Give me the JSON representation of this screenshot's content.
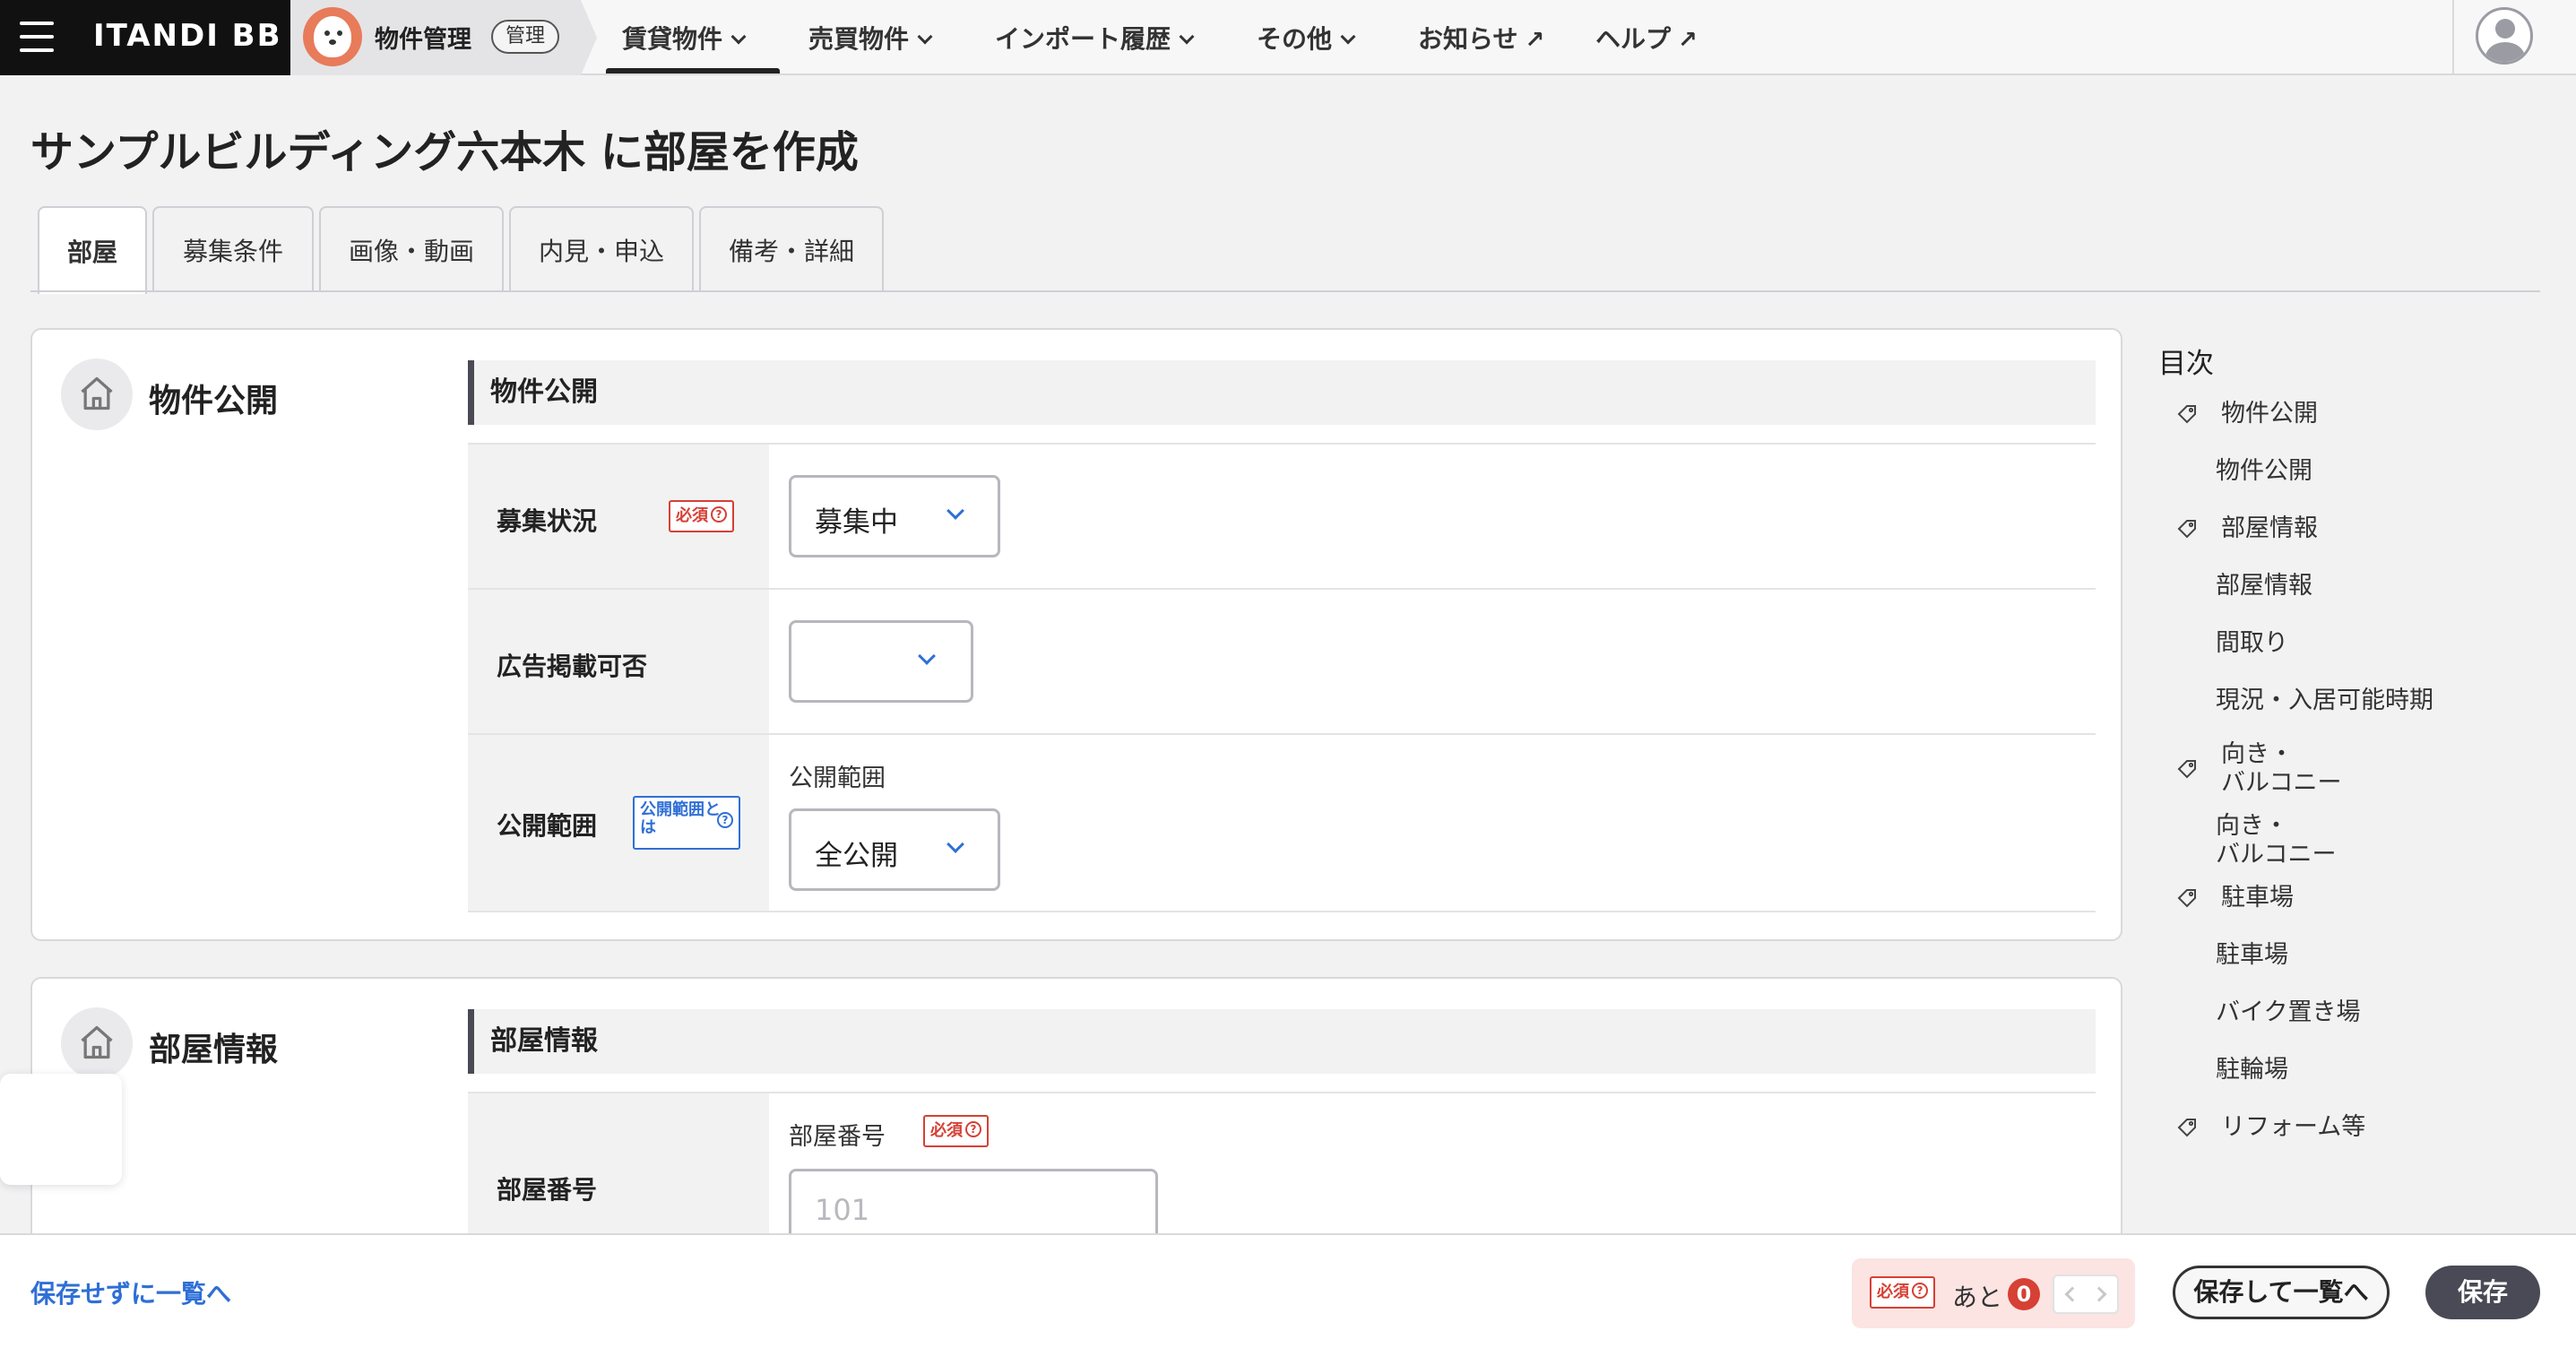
{
  "header": {
    "brand": "ITANDI BB",
    "product": "物件管理",
    "role_badge": "管理",
    "nav": [
      {
        "label": "賃貸物件",
        "icon": "chevron-down-icon"
      },
      {
        "label": "売買物件",
        "icon": "chevron-down-icon"
      },
      {
        "label": "インポート履歴",
        "icon": "chevron-down-icon"
      },
      {
        "label": "その他",
        "icon": "chevron-down-icon"
      },
      {
        "label": "お知らせ",
        "icon": "external-link-icon"
      },
      {
        "label": "ヘルプ",
        "icon": "external-link-icon"
      }
    ]
  },
  "page": {
    "title": "サンプルビルディング六本木 に部屋を作成",
    "tabs": [
      "部屋",
      "募集条件",
      "画像・動画",
      "内見・申込",
      "備考・詳細"
    ],
    "active_tab": "部屋"
  },
  "sections": {
    "publish": {
      "title": "物件公開",
      "group": "物件公開",
      "fields": {
        "recruit_status": {
          "label": "募集状況",
          "required": "必須",
          "value": "募集中"
        },
        "ad_allowed": {
          "label": "広告掲載可否",
          "value": ""
        },
        "scope": {
          "label": "公開範囲",
          "help": "公開範囲とは",
          "caption": "公開範囲",
          "value": "全公開"
        }
      }
    },
    "room_info": {
      "title": "部屋情報",
      "group": "部屋情報",
      "fields": {
        "room_number": {
          "label": "部屋番号",
          "caption": "部屋番号",
          "required": "必須",
          "placeholder": "101"
        }
      }
    }
  },
  "toc": {
    "title": "目次",
    "items": [
      {
        "label": "物件公開",
        "level": "section"
      },
      {
        "label": "物件公開",
        "level": "sub"
      },
      {
        "label": "部屋情報",
        "level": "section"
      },
      {
        "label": "部屋情報",
        "level": "sub"
      },
      {
        "label": "間取り",
        "level": "sub"
      },
      {
        "label": "現況・入居可能時期",
        "level": "sub"
      },
      {
        "label": "向き・",
        "label2": "バルコニー",
        "level": "section"
      },
      {
        "label": "向き・",
        "label2": "バルコニー",
        "level": "sub"
      },
      {
        "label": "駐車場",
        "level": "section"
      },
      {
        "label": "駐車場",
        "level": "sub"
      },
      {
        "label": "バイク置き場",
        "level": "sub"
      },
      {
        "label": "駐輪場",
        "level": "sub"
      },
      {
        "label": "リフォーム等",
        "level": "section"
      }
    ]
  },
  "footer": {
    "back_link": "保存せずに一覧へ",
    "required_badge": "必須",
    "remaining_label": "あと",
    "remaining_count": "0",
    "save_to_list": "保存して一覧へ",
    "save": "保存"
  },
  "colors": {
    "accent": "#2f6fd6",
    "required": "#d64035",
    "brand_bg": "#111111",
    "primary_button": "#4a4a56"
  }
}
